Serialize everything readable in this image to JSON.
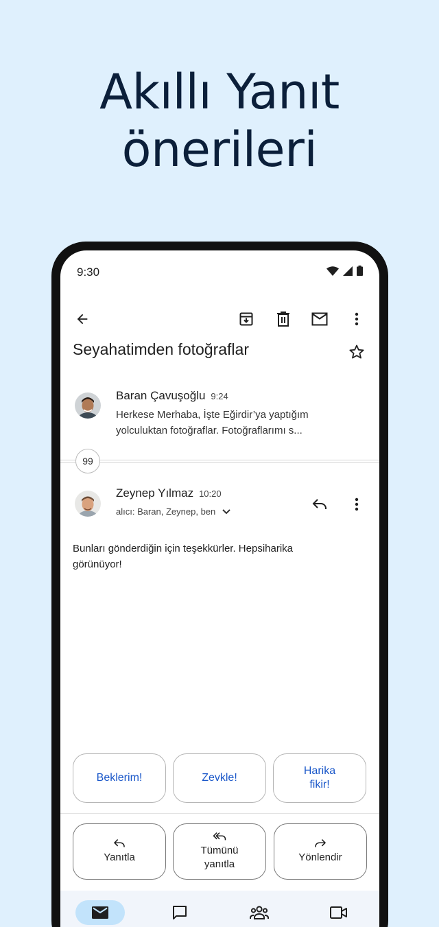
{
  "headline": {
    "line1": "Akıllı Yanıt",
    "line2": "önerileri"
  },
  "status_bar": {
    "time": "9:30",
    "icons": [
      "wifi-icon",
      "signal-icon",
      "battery-icon"
    ]
  },
  "toolbar": {
    "icons": [
      "back-arrow-icon",
      "archive-icon",
      "delete-icon",
      "mark-unread-icon",
      "more-vert-icon"
    ]
  },
  "email": {
    "subject": "Seyahatimden fotoğraflar",
    "star_icon": "star-outline-icon",
    "collapsed_count": "99",
    "messages": [
      {
        "sender": "Baran Çavuşoğlu",
        "time": "9:24",
        "snippet_line1": "Herkese Merhaba, İşte Eğirdir’ya yaptığım",
        "snippet_line2": "yolculuktan fotoğraflar. Fotoğraflarımı s..."
      },
      {
        "sender": "Zeynep Yılmaz",
        "time": "10:20",
        "recipients": "alıcı: Baran, Zeynep, ben",
        "body_line1": "Bunları gönderdiğin için teşekkürler. Hepsiharika",
        "body_line2": "görünüyor!"
      }
    ]
  },
  "smart_replies": [
    "Beklerim!",
    "Zevkle!",
    "Harika fikir!"
  ],
  "smart_reply_lines": {
    "third_line1": "Harika",
    "third_line2": "fikir!"
  },
  "actions": {
    "reply": {
      "label": "Yanıtla",
      "icon": "reply-icon"
    },
    "reply_all": {
      "label_line1": "Tümünü",
      "label_line2": "yanıtla",
      "icon": "reply-all-icon"
    },
    "forward": {
      "label": "Yönlendir",
      "icon": "forward-icon"
    }
  },
  "bottom_nav": [
    {
      "name": "mail",
      "icon": "mail-icon",
      "active": true
    },
    {
      "name": "chat",
      "icon": "chat-icon",
      "active": false
    },
    {
      "name": "spaces",
      "icon": "people-icon",
      "active": false
    },
    {
      "name": "meet",
      "icon": "video-icon",
      "active": false
    }
  ],
  "colors": {
    "background": "#dff0fd",
    "accent_text": "#1a57c9",
    "nav_active": "#c2e3fb",
    "headline": "#0b1f3a"
  }
}
